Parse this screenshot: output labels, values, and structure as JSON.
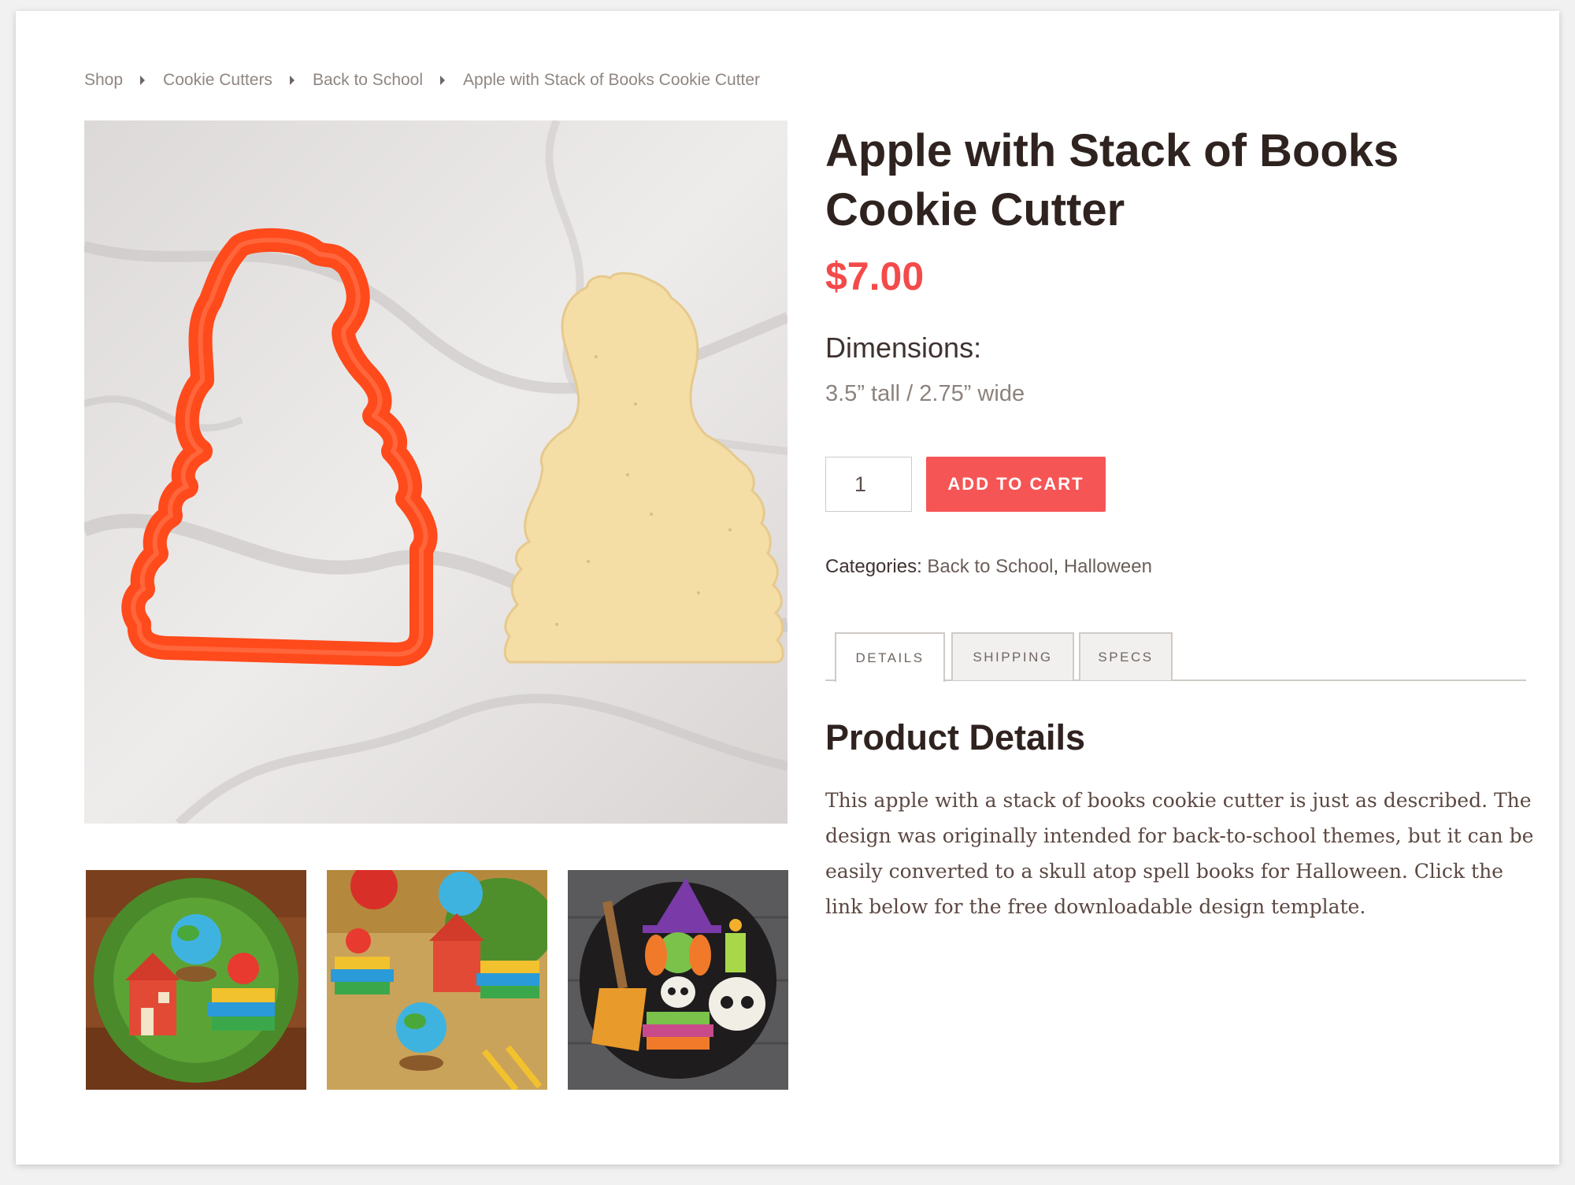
{
  "breadcrumb": {
    "items": [
      "Shop",
      "Cookie Cutters",
      "Back to School",
      "Apple with Stack of Books Cookie Cutter"
    ]
  },
  "product": {
    "title": "Apple with Stack of Books Cookie Cutter",
    "price": "$7.00",
    "dimensions_label": "Dimensions:",
    "dimensions_value": "3.5” tall / 2.75” wide",
    "quantity": "1",
    "add_to_cart_label": "ADD TO CART",
    "categories_label": "Categories:",
    "categories": [
      "Back to School",
      "Halloween"
    ],
    "categories_separator": ","
  },
  "tabs": [
    {
      "label": "DETAILS",
      "active": true
    },
    {
      "label": "SHIPPING",
      "active": false
    },
    {
      "label": "SPECS",
      "active": false
    }
  ],
  "details": {
    "heading": "Product Details",
    "text": "This apple with a stack of books cookie cutter is just as described. The design was originally intended for back-to-school themes, but it can be easily converted to a skull atop spell books for Halloween. Click the link below for the free downloadable design template."
  },
  "colors": {
    "accent": "#f65555",
    "price": "#f44a4a",
    "cutter": "#ff4a1c",
    "dough": "#f5dda6",
    "marble": "#e9e7e6"
  },
  "icons": {
    "breadcrumb_separator": "caret-right-icon"
  }
}
